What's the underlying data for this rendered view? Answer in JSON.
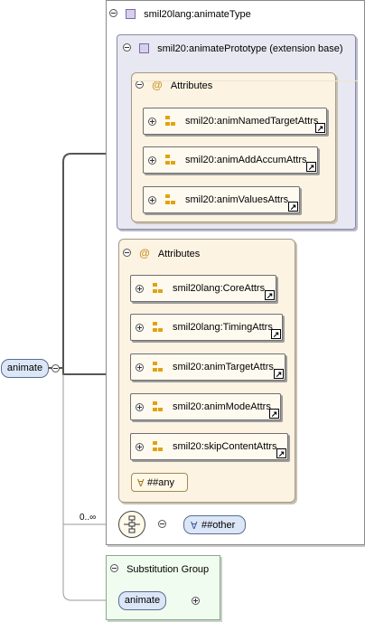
{
  "type_box": {
    "title": "smil20lang:animateType"
  },
  "prototype_box": {
    "title": "smil20:animatePrototype (extension base)"
  },
  "inner_attributes": {
    "title": "Attributes",
    "groups": [
      "smil20:animNamedTargetAttrs",
      "smil20:animAddAccumAttrs",
      "smil20:animValuesAttrs"
    ]
  },
  "outer_attributes": {
    "title": "Attributes",
    "groups": [
      "smil20lang:CoreAttrs",
      "smil20lang:TimingAttrs",
      "smil20:animTargetAttrs",
      "smil20:animModeAttrs",
      "smil20:skipContentAttrs"
    ],
    "any_attribute": "##any"
  },
  "root_element": {
    "name": "animate"
  },
  "sequence": {
    "cardinality": "0..∞",
    "wildcard": "##other"
  },
  "substitution_group": {
    "title": "Substitution Group",
    "element": "animate"
  },
  "icons": {
    "wildcard_symbol": "∀",
    "at_symbol": "@",
    "link_symbol": "↗"
  },
  "colors": {
    "element": "#dbe6f7",
    "attributes": "#fdf3e3",
    "prototype": "#e8e8f3",
    "substitution": "#f0fcef"
  }
}
